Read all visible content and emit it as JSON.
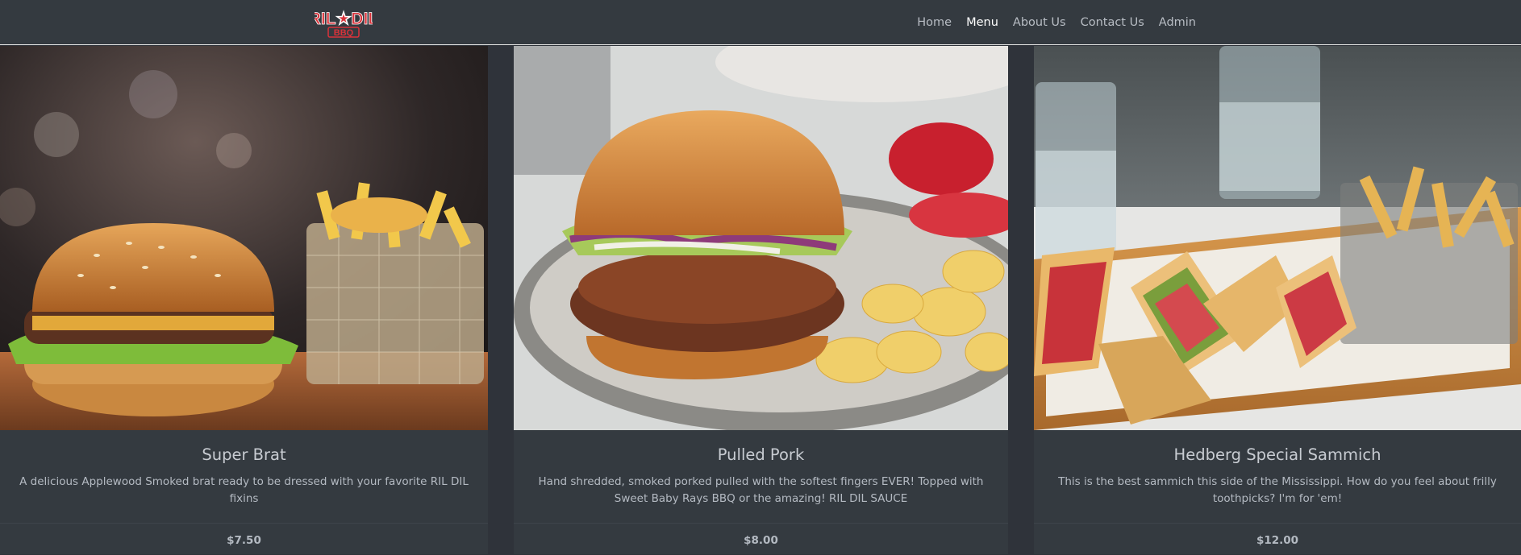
{
  "navbar": {
    "logo_text_top": "RIL★DIL",
    "logo_text_bottom": "BBQ",
    "links": [
      {
        "label": "Home",
        "active": false
      },
      {
        "label": "Menu",
        "active": true
      },
      {
        "label": "About Us",
        "active": false
      },
      {
        "label": "Contact Us",
        "active": false
      },
      {
        "label": "Admin",
        "active": false
      }
    ]
  },
  "menu": {
    "items": [
      {
        "title": "Super Brat",
        "description": "A delicious Applewood Smoked brat ready to be dressed with your favorite RIL DIL fixins",
        "price": "$7.50",
        "image": "burger-and-fries-photo"
      },
      {
        "title": "Pulled Pork",
        "description": "Hand shredded, smoked porked pulled with the softest fingers EVER! Topped with Sweet Baby Rays BBQ or the amazing! RIL DIL SAUCE",
        "price": "$8.00",
        "image": "pulled-pork-sandwich-photo"
      },
      {
        "title": "Hedberg Special Sammich",
        "description": "This is the best sammich this side of the Mississippi. How do you feel about frilly toothpicks? I'm for 'em!",
        "price": "$12.00",
        "image": "club-sandwich-photo"
      }
    ]
  },
  "colors": {
    "page_bg": "#2f333a",
    "card_bg": "#343a40",
    "brand_red": "#d9323a"
  }
}
